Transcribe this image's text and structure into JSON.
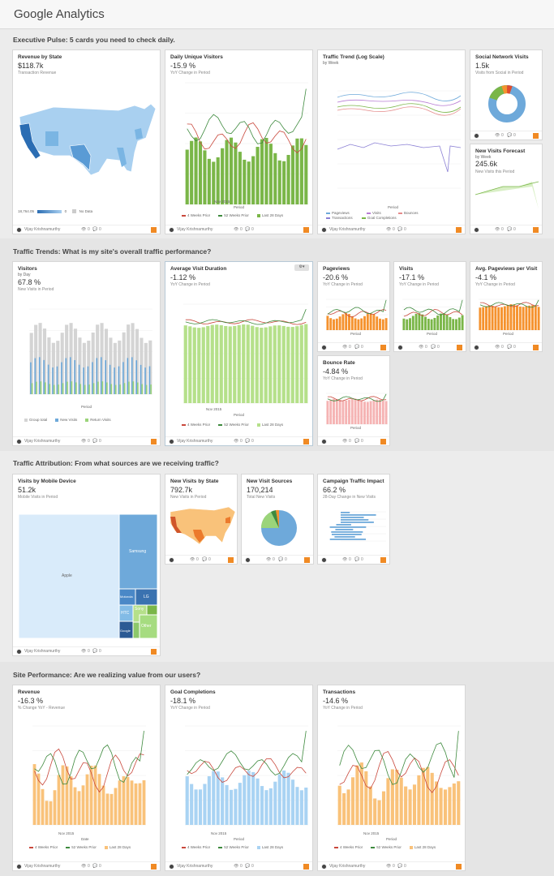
{
  "app": {
    "title": "Google Analytics"
  },
  "colors": {
    "green": "#7ab648",
    "red": "#c9483c",
    "darkgreen": "#3e8a3e",
    "blue": "#6ea9da",
    "orange": "#f5922e",
    "lightblue": "#a9d3f3",
    "pink": "#f5b3b3",
    "lightgreen": "#b5e08a",
    "gray": "#d4d4d4"
  },
  "user": {
    "name": "Vijay Krishnamurthy",
    "views": "0",
    "comments": "0"
  },
  "sections": [
    {
      "title": "Executive Pulse: 5 cards you need to check daily."
    },
    {
      "title": "Traffic Trends: What is my site's overall traffic performance?"
    },
    {
      "title": "Traffic Attribution: From what sources are we receiving traffic?"
    },
    {
      "title": "Site Performance: Are we realizing value from our users?"
    }
  ],
  "cards": {
    "revenue_state": {
      "title": "Revenue by State",
      "value": "$118.7k",
      "label": "Transaction Revenue",
      "legend_min": "18,764.05",
      "legend_zero": "0",
      "legend_nodata": "No Data"
    },
    "daily_unique": {
      "title": "Daily Unique Visitors",
      "value": "-15.9 %",
      "label": "YoY Change in Period",
      "ylabel": "Daily Unique Visitors",
      "xlabel": "Period",
      "month": "Nov 2015"
    },
    "traffic_trend": {
      "title": "Traffic Trend (Log Scale)",
      "subtitle": "by Week",
      "ylabel": "Amount",
      "xlabel": "Period",
      "legend": [
        "Pageviews",
        "Visits",
        "Bounces",
        "Transactions",
        "Goal Completions"
      ]
    },
    "social": {
      "title": "Social Network Visits",
      "value": "1.5k",
      "label": "Visits from Social in Period"
    },
    "forecast": {
      "title": "New Visits Forecast",
      "subtitle": "by Week",
      "value": "245.6k",
      "label": "New Visits this Period"
    },
    "visitors": {
      "title": "Visitors",
      "subtitle": "by Day",
      "value": "67.8 %",
      "label": "New Visits in Period",
      "ylabel": "Visits",
      "xlabel": "Period",
      "legend": [
        "Group total",
        "New Visits",
        "Return Visits"
      ]
    },
    "avg_duration": {
      "title": "Average Visit Duration",
      "value": "-1.12 %",
      "label": "YoY Change in Period",
      "ylabel": "Average Visit Duration (Minutes)",
      "xlabel": "Period",
      "month": "Nov 2015"
    },
    "pageviews": {
      "title": "Pageviews",
      "value": "-20.6 %",
      "label": "YoY Change in Period",
      "xlabel": "Period"
    },
    "visits": {
      "title": "Visits",
      "value": "-17.1 %",
      "label": "YoY Change in Period",
      "xlabel": "Period"
    },
    "avg_pageviews": {
      "title": "Avg. Pageviews per Visit",
      "value": "-4.1 %",
      "label": "YoY Change in Period",
      "xlabel": "Period"
    },
    "bounce": {
      "title": "Bounce Rate",
      "value": "-4.84 %",
      "label": "YoY Change in Period",
      "xlabel": "Period"
    },
    "mobile": {
      "title": "Visits by Mobile Device",
      "value": "51.2k",
      "label": "Mobile Visits in Period",
      "devices": [
        "Apple",
        "Samsung",
        "Motorola",
        "LG",
        "HTC",
        "Sony",
        "Other",
        "Google"
      ]
    },
    "new_visits_state": {
      "title": "New Visits by State",
      "value": "792.7k",
      "label": "New Visits in Period"
    },
    "new_visit_sources": {
      "title": "New Visit Sources",
      "value": "170,214",
      "label": "Total New Visits"
    },
    "campaign": {
      "title": "Campaign Traffic Impact",
      "value": "66.2 %",
      "label": "28-Day Change in New Visits"
    },
    "revenue": {
      "title": "Revenue",
      "value": "-16.3 %",
      "label": "% Change YoY - Revenue",
      "ylabel": "Revenue",
      "xlabel": "Date",
      "month": "Nov 2015"
    },
    "goals": {
      "title": "Goal Completions",
      "value": "-18.1 %",
      "label": "YoY Change in Period",
      "ylabel": "Goal Completions",
      "xlabel": "Period",
      "month": "Nov 2015"
    },
    "transactions": {
      "title": "Transactions",
      "value": "-14.6 %",
      "label": "YoY Change in Period",
      "ylabel": "Transactions",
      "xlabel": "Period",
      "month": "Nov 2015"
    }
  },
  "line_legend": [
    "4 Weeks Prior",
    "52 Weeks Prior",
    "Last 28 Days"
  ]
}
